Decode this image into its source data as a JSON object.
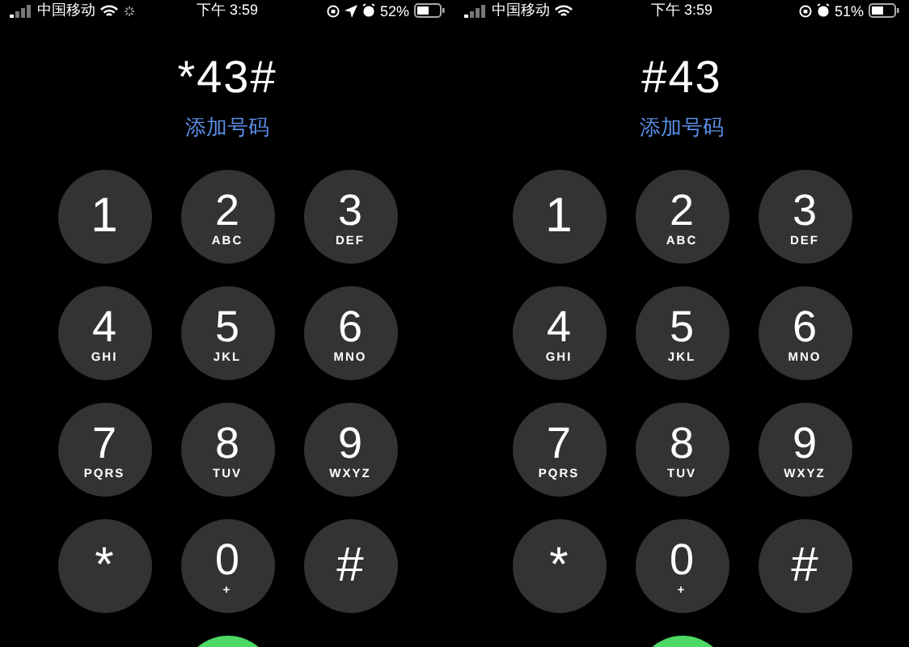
{
  "phones": [
    {
      "status": {
        "carrier": "中国移动",
        "time": "下午 3:59",
        "battery": "52%",
        "activity": true,
        "location": true
      },
      "number": "*43#",
      "add_label": "添加号码",
      "keys": [
        {
          "digit": "1"
        },
        {
          "digit": "2",
          "letters": "ABC"
        },
        {
          "digit": "3",
          "letters": "DEF"
        },
        {
          "digit": "4",
          "letters": "GHI"
        },
        {
          "digit": "5",
          "letters": "JKL"
        },
        {
          "digit": "6",
          "letters": "MNO"
        },
        {
          "digit": "7",
          "letters": "PQRS"
        },
        {
          "digit": "8",
          "letters": "TUV"
        },
        {
          "digit": "9",
          "letters": "WXYZ"
        },
        {
          "digit": "*"
        },
        {
          "digit": "0",
          "letters": "+"
        },
        {
          "digit": "#"
        }
      ]
    },
    {
      "status": {
        "carrier": "中国移动",
        "time": "下午 3:59",
        "battery": "51%",
        "activity": false,
        "location": false
      },
      "number": "#43",
      "add_label": "添加号码",
      "keys": [
        {
          "digit": "1"
        },
        {
          "digit": "2",
          "letters": "ABC"
        },
        {
          "digit": "3",
          "letters": "DEF"
        },
        {
          "digit": "4",
          "letters": "GHI"
        },
        {
          "digit": "5",
          "letters": "JKL"
        },
        {
          "digit": "6",
          "letters": "MNO"
        },
        {
          "digit": "7",
          "letters": "PQRS"
        },
        {
          "digit": "8",
          "letters": "TUV"
        },
        {
          "digit": "9",
          "letters": "WXYZ"
        },
        {
          "digit": "*"
        },
        {
          "digit": "0",
          "letters": "+"
        },
        {
          "digit": "#"
        }
      ]
    }
  ]
}
